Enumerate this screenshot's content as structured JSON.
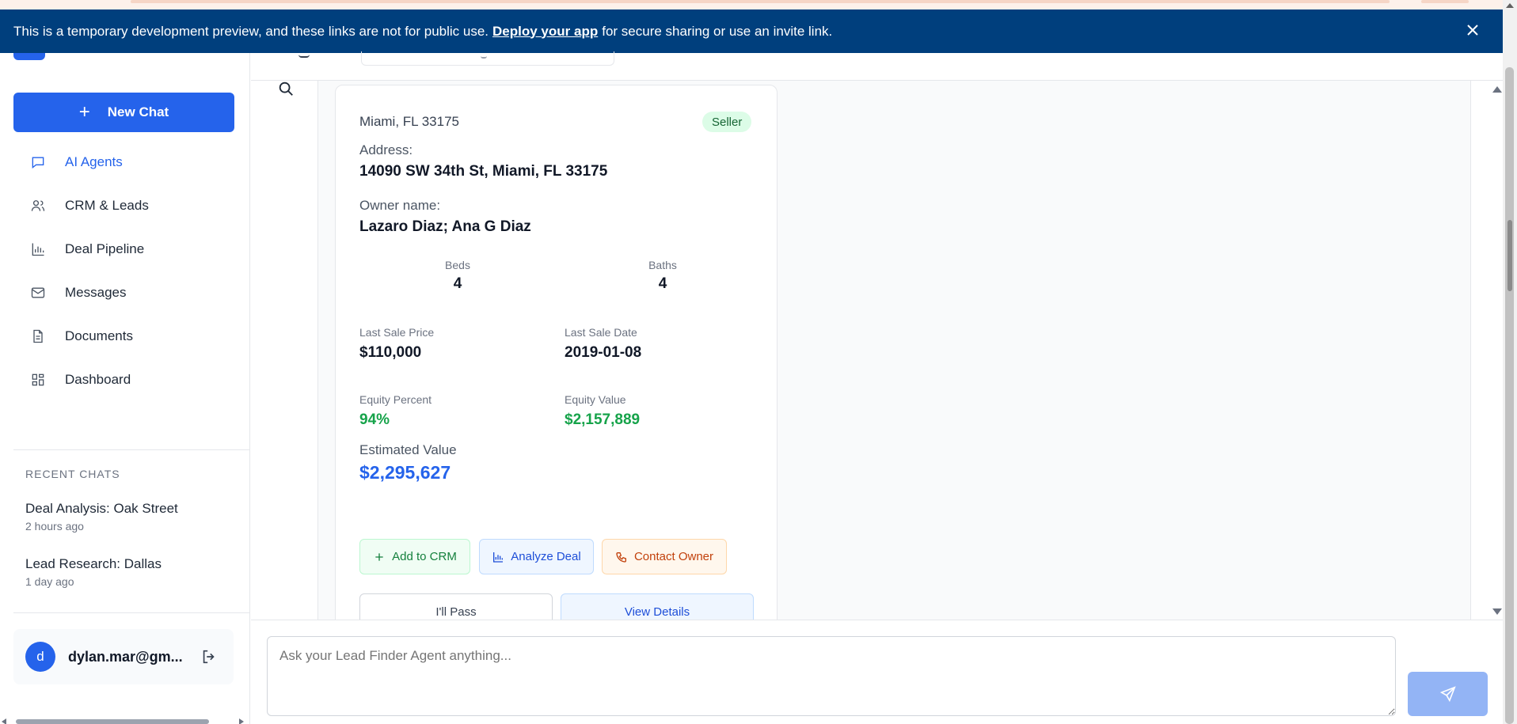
{
  "banner": {
    "text_before": "This is a temporary development preview, and these links are not for public use.",
    "link": "Deploy your app",
    "text_after": "for secure sharing or use an invite link."
  },
  "sidebar": {
    "new_chat": "New Chat",
    "nav": [
      {
        "label": "AI Agents",
        "icon": "chat-bubble-icon",
        "active": true
      },
      {
        "label": "CRM & Leads",
        "icon": "users-icon"
      },
      {
        "label": "Deal Pipeline",
        "icon": "bar-chart-icon"
      },
      {
        "label": "Messages",
        "icon": "mail-icon"
      },
      {
        "label": "Documents",
        "icon": "document-icon"
      },
      {
        "label": "Dashboard",
        "icon": "grid-icon"
      }
    ],
    "recent_title": "RECENT CHATS",
    "recent": [
      {
        "title": "Deal Analysis: Oak Street",
        "time": "2 hours ago"
      },
      {
        "title": "Lead Research: Dallas",
        "time": "1 day ago"
      }
    ],
    "user": {
      "initial": "d",
      "name": "dylan.mar@gm..."
    }
  },
  "card": {
    "location": "Miami, FL 33175",
    "badge": "Seller",
    "address_label": "Address:",
    "address": "14090 SW 34th St, Miami, FL 33175",
    "owner_label": "Owner name:",
    "owner": "Lazaro Diaz; Ana G Diaz",
    "beds_label": "Beds",
    "beds": "4",
    "baths_label": "Baths",
    "baths": "4",
    "last_sale_price_label": "Last Sale Price",
    "last_sale_price": "$110,000",
    "last_sale_date_label": "Last Sale Date",
    "last_sale_date": "2019-01-08",
    "equity_percent_label": "Equity Percent",
    "equity_percent": "94%",
    "equity_value_label": "Equity Value",
    "equity_value": "$2,157,889",
    "estimated_value_label": "Estimated Value",
    "estimated_value": "$2,295,627",
    "actions": {
      "add_crm": "Add to CRM",
      "analyze": "Analyze Deal",
      "contact": "Contact Owner",
      "pass": "I'll Pass",
      "view": "View Details"
    }
  },
  "composer": {
    "placeholder": "Ask your Lead Finder Agent anything..."
  },
  "colors": {
    "primary": "#2563eb",
    "banner": "#003f7d",
    "green": "#16a34a",
    "orange": "#c2410c"
  }
}
